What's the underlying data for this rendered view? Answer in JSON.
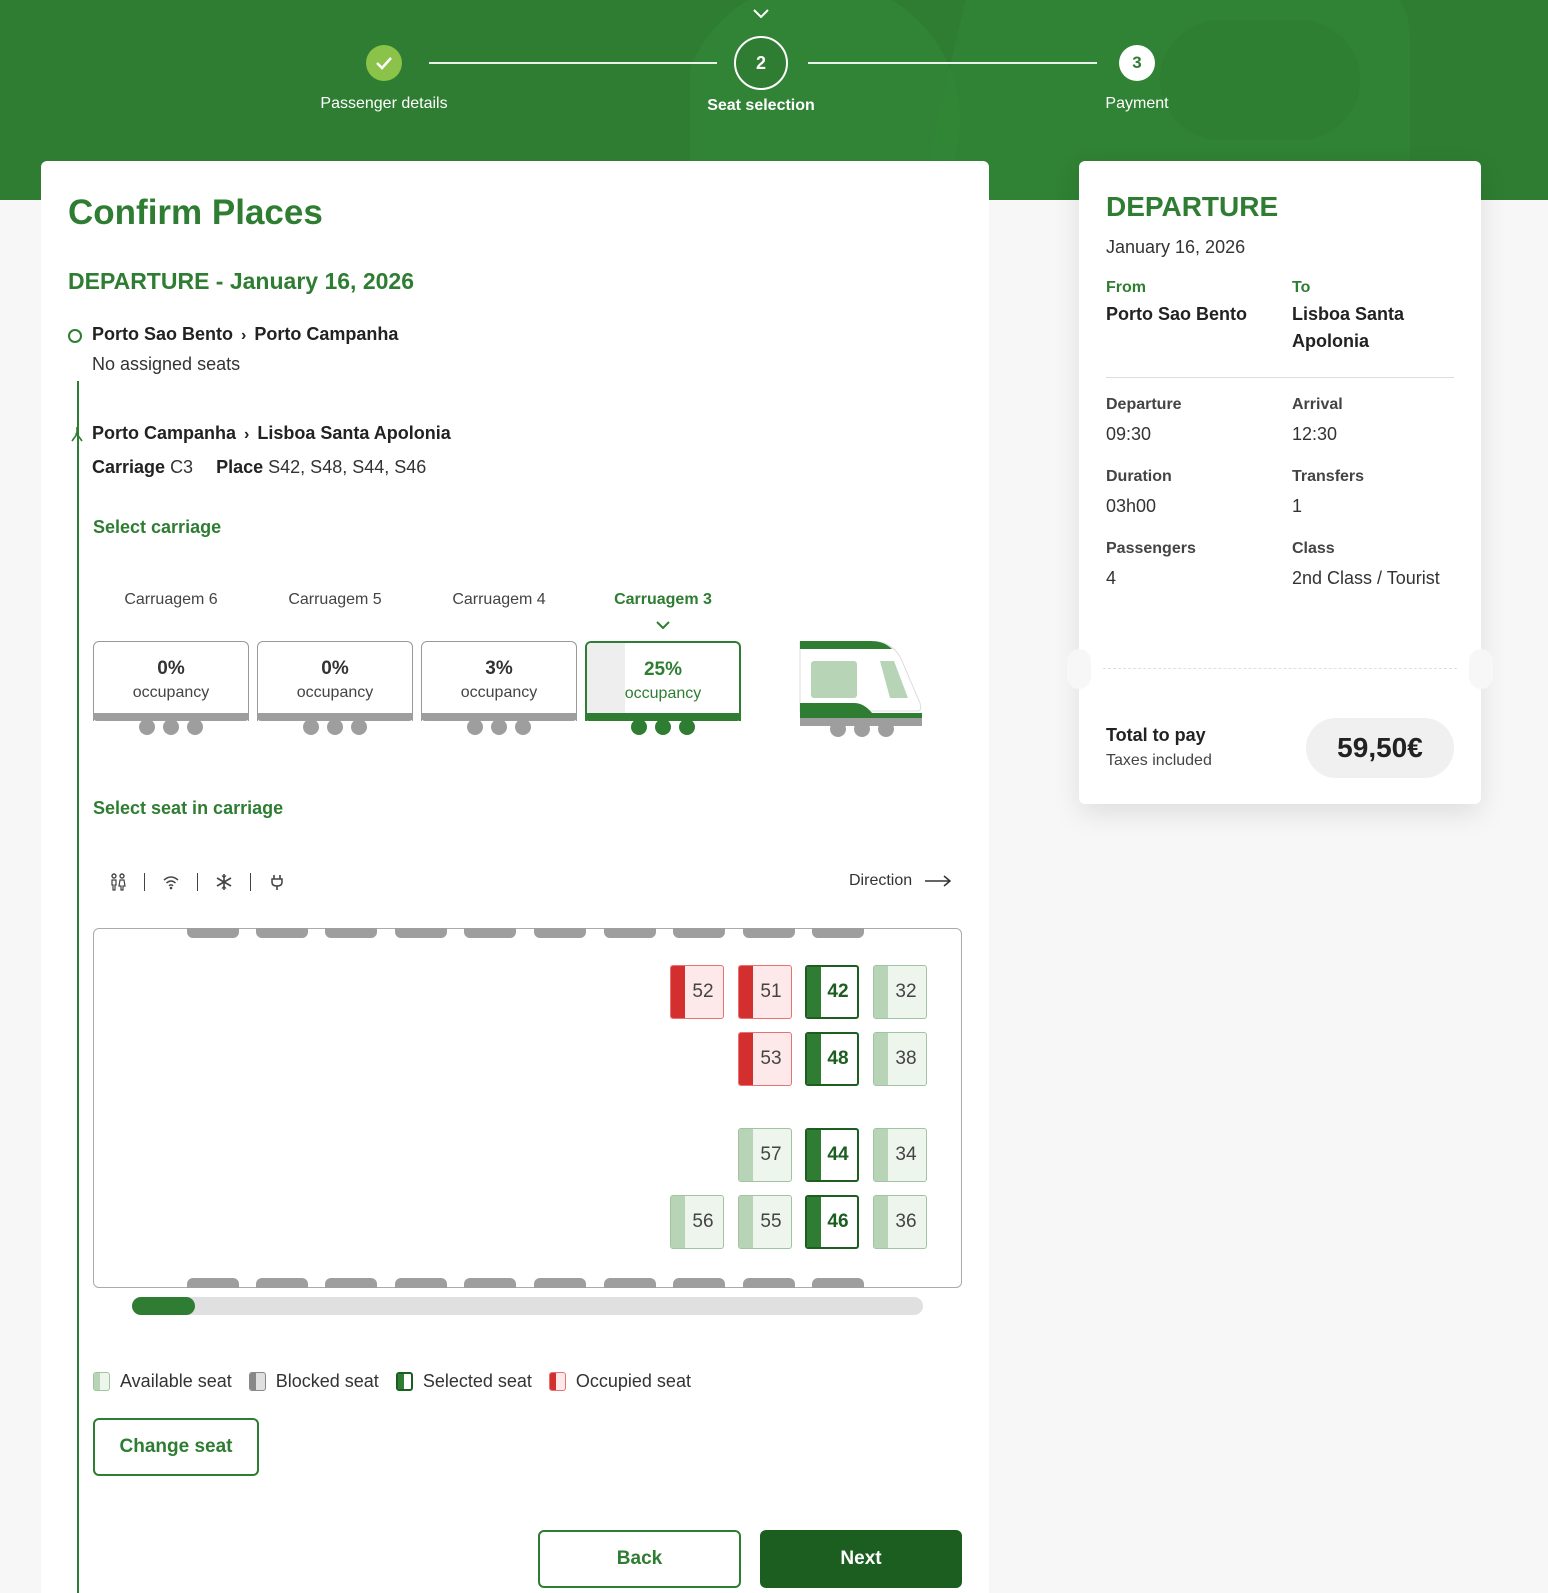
{
  "stepper": {
    "steps": [
      {
        "number": "",
        "label": "Passenger details",
        "state": "done"
      },
      {
        "number": "2",
        "label": "Seat selection",
        "state": "current"
      },
      {
        "number": "3",
        "label": "Payment",
        "state": "upcoming"
      }
    ]
  },
  "main": {
    "title": "Confirm Places",
    "departure_heading": "DEPARTURE - January 16, 2026",
    "segments": [
      {
        "from": "Porto Sao Bento",
        "arrow": "›",
        "to": "Porto Campanha",
        "note": "No assigned seats"
      },
      {
        "from": "Porto Campanha",
        "arrow": "›",
        "to": "Lisboa Santa Apolonia",
        "carriage_label": "Carriage",
        "carriage_value": "C3",
        "place_label": "Place",
        "place_value": "S42, S48, S44, S46"
      }
    ],
    "select_carriage_label": "Select carriage",
    "carriages": [
      {
        "name": "Carruagem 6",
        "percent": "0%",
        "occupancy_label": "occupancy"
      },
      {
        "name": "Carruagem 5",
        "percent": "0%",
        "occupancy_label": "occupancy"
      },
      {
        "name": "Carruagem 4",
        "percent": "3%",
        "occupancy_label": "occupancy"
      },
      {
        "name": "Carruagem 3",
        "percent": "25%",
        "occupancy_label": "occupancy",
        "selected": true
      }
    ],
    "select_seat_label": "Select seat in carriage",
    "amenity_icons": [
      "restroom-icon",
      "wifi-icon",
      "air-conditioning-icon",
      "power-outlet-icon"
    ],
    "direction_label": "Direction",
    "seats": [
      {
        "number": "52",
        "status": "occupied"
      },
      {
        "number": "51",
        "status": "occupied"
      },
      {
        "number": "42",
        "status": "selected"
      },
      {
        "number": "32",
        "status": "available"
      },
      {
        "number": "53",
        "status": "occupied"
      },
      {
        "number": "48",
        "status": "selected"
      },
      {
        "number": "38",
        "status": "available"
      },
      {
        "number": "57",
        "status": "available"
      },
      {
        "number": "44",
        "status": "selected"
      },
      {
        "number": "34",
        "status": "available"
      },
      {
        "number": "56",
        "status": "available"
      },
      {
        "number": "55",
        "status": "available"
      },
      {
        "number": "46",
        "status": "selected"
      },
      {
        "number": "36",
        "status": "available"
      }
    ],
    "scroll_position": 0.08,
    "legend": {
      "available": "Available seat",
      "blocked": "Blocked seat",
      "selected": "Selected seat",
      "occupied": "Occupied seat"
    },
    "change_seat_label": "Change seat",
    "back_label": "Back",
    "next_label": "Next"
  },
  "summary": {
    "title": "DEPARTURE",
    "date": "January 16, 2026",
    "from_label": "From",
    "from_value": "Porto Sao Bento",
    "to_label": "To",
    "to_value": "Lisboa Santa Apolonia",
    "departure_label": "Departure",
    "departure_value": "09:30",
    "arrival_label": "Arrival",
    "arrival_value": "12:30",
    "duration_label": "Duration",
    "duration_value": "03h00",
    "transfers_label": "Transfers",
    "transfers_value": "1",
    "passengers_label": "Passengers",
    "passengers_value": "4",
    "class_label": "Class",
    "class_value": "2nd Class / Tourist",
    "total_label": "Total to pay",
    "taxes_label": "Taxes included",
    "total_value": "59,50€"
  },
  "colors": {
    "brand_green": "#2e7d32",
    "dark_green": "#1b5e20",
    "done_step": "#8bc34a",
    "occupied_red": "#d32f2f"
  }
}
